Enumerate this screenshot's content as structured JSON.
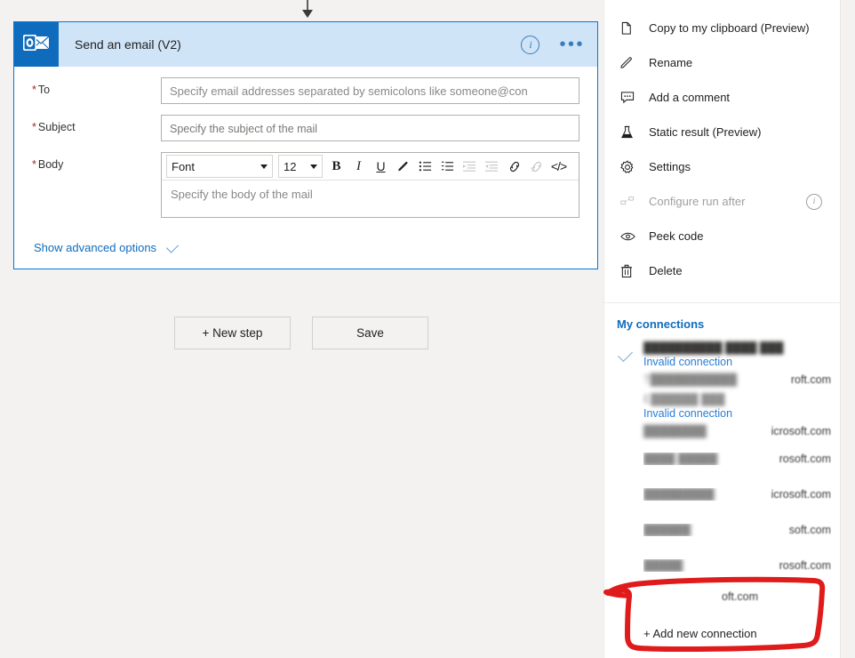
{
  "card": {
    "icon_name": "outlook-icon",
    "title": "Send an email (V2)",
    "info_glyph": "i",
    "ellipsis_glyph": "•••",
    "fields": {
      "to": {
        "label": "To",
        "required_mark": "*",
        "value": "",
        "placeholder": "Specify email addresses separated by semicolons like someone@con"
      },
      "subject": {
        "label": "Subject",
        "required_mark": "*",
        "value": "",
        "placeholder": "Specify the subject of the mail"
      },
      "body": {
        "label": "Body",
        "required_mark": "*",
        "value": "",
        "placeholder": "Specify the body of the mail"
      }
    },
    "rte_toolbar": {
      "font_label": "Font",
      "size_label": "12",
      "buttons": [
        {
          "name": "bold-icon",
          "glyph": "B",
          "disabled": false
        },
        {
          "name": "italic-icon",
          "glyph": "I",
          "disabled": false
        },
        {
          "name": "underline-icon",
          "glyph": "U",
          "disabled": false
        },
        {
          "name": "text-color-pen-icon",
          "glyph": "✎",
          "disabled": false
        },
        {
          "name": "bulleted-list-icon",
          "glyph": "☰",
          "disabled": false
        },
        {
          "name": "numbered-list-icon",
          "glyph": "☰",
          "disabled": false
        },
        {
          "name": "decrease-indent-icon",
          "glyph": "☰",
          "disabled": true
        },
        {
          "name": "increase-indent-icon",
          "glyph": "☰",
          "disabled": true
        },
        {
          "name": "insert-link-icon",
          "glyph": "ὑ7",
          "disabled": false
        },
        {
          "name": "remove-link-icon",
          "glyph": "ὑ7",
          "disabled": true
        },
        {
          "name": "code-view-icon",
          "glyph": "</>",
          "disabled": false
        }
      ]
    },
    "advanced_options_label": "Show advanced options"
  },
  "canvas_buttons": {
    "new_step": "+ New step",
    "save": "Save"
  },
  "panel": {
    "menu": [
      {
        "label": "Copy to my clipboard (Preview)",
        "icon": "copy-icon",
        "disabled": false,
        "trailing_icon": null
      },
      {
        "label": "Rename",
        "icon": "pencil-icon",
        "disabled": false,
        "trailing_icon": null
      },
      {
        "label": "Add a comment",
        "icon": "comment-icon",
        "disabled": false,
        "trailing_icon": null
      },
      {
        "label": "Static result (Preview)",
        "icon": "flask-icon",
        "disabled": false,
        "trailing_icon": null
      },
      {
        "label": "Settings",
        "icon": "gear-icon",
        "disabled": false,
        "trailing_icon": null
      },
      {
        "label": "Configure run after",
        "icon": "run-after-icon",
        "disabled": true,
        "trailing_icon": "info-icon"
      },
      {
        "label": "Peek code",
        "icon": "eye-icon",
        "disabled": false,
        "trailing_icon": null
      },
      {
        "label": "Delete",
        "icon": "trash-icon",
        "disabled": false,
        "trailing_icon": null
      }
    ],
    "connections_header": "My connections",
    "connections": [
      {
        "selected": true,
        "masked_primary": "██████████   ████   ███",
        "status": "Invalid connection",
        "masked_secondary_left": "T███████████",
        "masked_secondary_right": "roft.com"
      },
      {
        "selected": false,
        "masked_primary": "E██████   ███",
        "status": "Invalid connection",
        "masked_secondary_left": "████████",
        "masked_secondary_right": "icrosoft.com"
      }
    ],
    "connection_rows": [
      {
        "masked_left": "████  █████",
        "masked_right": "rosoft.com"
      },
      {
        "masked_left": "█████████",
        "masked_right": "icrosoft.com"
      },
      {
        "masked_left": "██████",
        "masked_right": "soft.com"
      },
      {
        "masked_left": "█████",
        "masked_right": "rosoft.com"
      },
      {
        "masked_left": "",
        "masked_right": "oft.com"
      }
    ],
    "add_connection_label": "+ Add new connection"
  },
  "annotation": {
    "shape": "hand-drawn-red-oval",
    "color": "#e01b1b",
    "targets": "+ Add new connection"
  },
  "colors": {
    "accent": "#0078d4",
    "card_header_bg": "#cfe4f7",
    "icon_bg": "#0f6cbd",
    "link": "#0f6cbd",
    "required": "#a4262c",
    "canvas_bg": "#f3f2f1",
    "annotation_red": "#e01b1b"
  }
}
